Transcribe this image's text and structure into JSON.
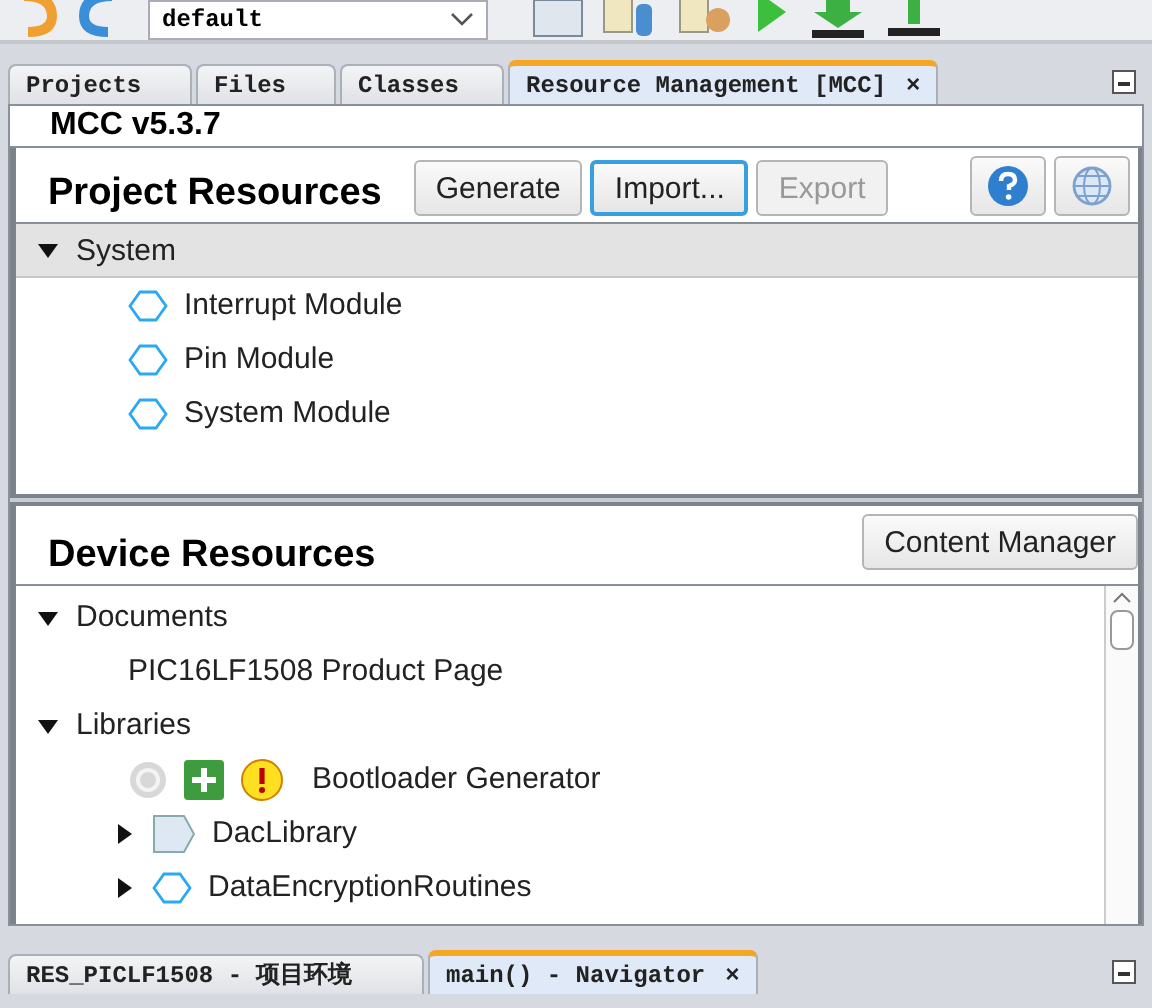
{
  "toolbar": {
    "configuration": "default"
  },
  "tabs": [
    {
      "label": "Projects",
      "selected": false
    },
    {
      "label": "Files",
      "selected": false
    },
    {
      "label": "Classes",
      "selected": false
    },
    {
      "label": "Resource Management [MCC]",
      "selected": true,
      "close": "×"
    }
  ],
  "version": "MCC v5.3.7",
  "project_resources": {
    "title": "Project Resources",
    "buttons": [
      {
        "label": "Generate",
        "disabled": false,
        "focused": false
      },
      {
        "label": "Import...",
        "disabled": false,
        "focused": true
      },
      {
        "label": "Export",
        "disabled": true,
        "focused": false
      }
    ],
    "tree": [
      {
        "label": "System",
        "expanded": true,
        "children": [
          {
            "label": "Interrupt Module",
            "kind": "module"
          },
          {
            "label": "Pin Module",
            "kind": "module"
          },
          {
            "label": "System Module",
            "kind": "module"
          }
        ]
      }
    ]
  },
  "device_resources": {
    "title": "Device Resources",
    "button": "Content Manager",
    "tree": [
      {
        "label": "Documents",
        "expanded": true,
        "children": [
          {
            "label": "PIC16LF1508 Product Page",
            "kind": "document"
          }
        ]
      },
      {
        "label": "Libraries",
        "expanded": true,
        "children": [
          {
            "label": "Bootloader Generator",
            "kind": "status"
          },
          {
            "label": "DacLibrary",
            "kind": "dac",
            "expanded": false
          },
          {
            "label": "DataEncryptionRoutines",
            "kind": "module",
            "expanded": false
          }
        ]
      }
    ]
  },
  "bottom_tabs": [
    {
      "label": "RES_PICLF1508 - 项目环境",
      "selected": false
    },
    {
      "label": "main() - Navigator",
      "selected": true,
      "close": "×"
    }
  ]
}
